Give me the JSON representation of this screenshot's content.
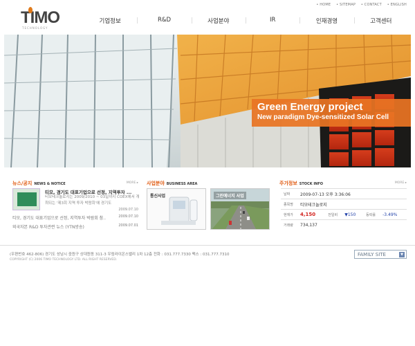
{
  "util_links": [
    "• HOME",
    "• SITEMAP",
    "• CONTACT",
    "• ENGLISH"
  ],
  "logo": {
    "text": "TIMO",
    "sub": "TECHNOLOGY"
  },
  "gnb": [
    "기업정보",
    "R&D",
    "사업분야",
    "IR",
    "인재경영",
    "고객센터"
  ],
  "hero": {
    "title": "Green Energy project",
    "subtitle": "New paradigm Dye-sensitized Solar Cell"
  },
  "news": {
    "title": "뉴스/공지",
    "title_en": "NEWS & NOTICE",
    "more": "MORE ▸",
    "featured_title": "티모, 경기도 대표기업으로 선정, 지역투자 ...",
    "featured_summary": "티모테크놀로지는 2009/2010 ~ 03일까지 COEX에서 개최되는 '제3회 지역 투자 박람회'에 경기도",
    "featured_date": "2009.07.10",
    "items": [
      {
        "title": "티모, 경기도 대표기업으로 선정, 지역투자 박람회 참..",
        "date": "2009.07.10"
      },
      {
        "title": "외국자본 R&D 투자관련 뉴스 (YTN방송)",
        "date": "2009.07.01"
      }
    ]
  },
  "business": {
    "title": "사업분야",
    "title_en": "BUSINESS AREA",
    "cards": [
      "통신사업",
      "그린에너지 사업"
    ]
  },
  "stock": {
    "title": "주가정보",
    "title_en": "STOCK INFO",
    "more": "MORE ▸",
    "rows": [
      {
        "k": "날짜",
        "v": "2009-07-13 오후 3:36:06"
      },
      {
        "k": "종목명",
        "v": "티모테크놀로지"
      },
      {
        "k": "현재가",
        "v": "4,150",
        "k2": "전일비",
        "v2": "▼150",
        "k3": "등락률",
        "v3": "-3.49%"
      },
      {
        "k": "거래량",
        "v": "734,137"
      }
    ]
  },
  "footer": {
    "address": "(우편번호 462-806) 경기도 성남시 중원구 상대원동 311-3 우림라이온스밸리 1차 12층   전화 : 031.777.7330    팩스 : 031.777.7310",
    "copyright": "COPYRIGHT (C) 2006 TIMO TECHNOLOGY LTD. ALL RIGHT RESERVED.",
    "family_site": "FAMILY SITE"
  },
  "colors": {
    "accent": "#e05a10",
    "hero_caption": "#e87424",
    "price": "#d2231e",
    "down": "#1f3fa8"
  },
  "icons": {
    "family_arrow": "chevron-down-icon"
  }
}
